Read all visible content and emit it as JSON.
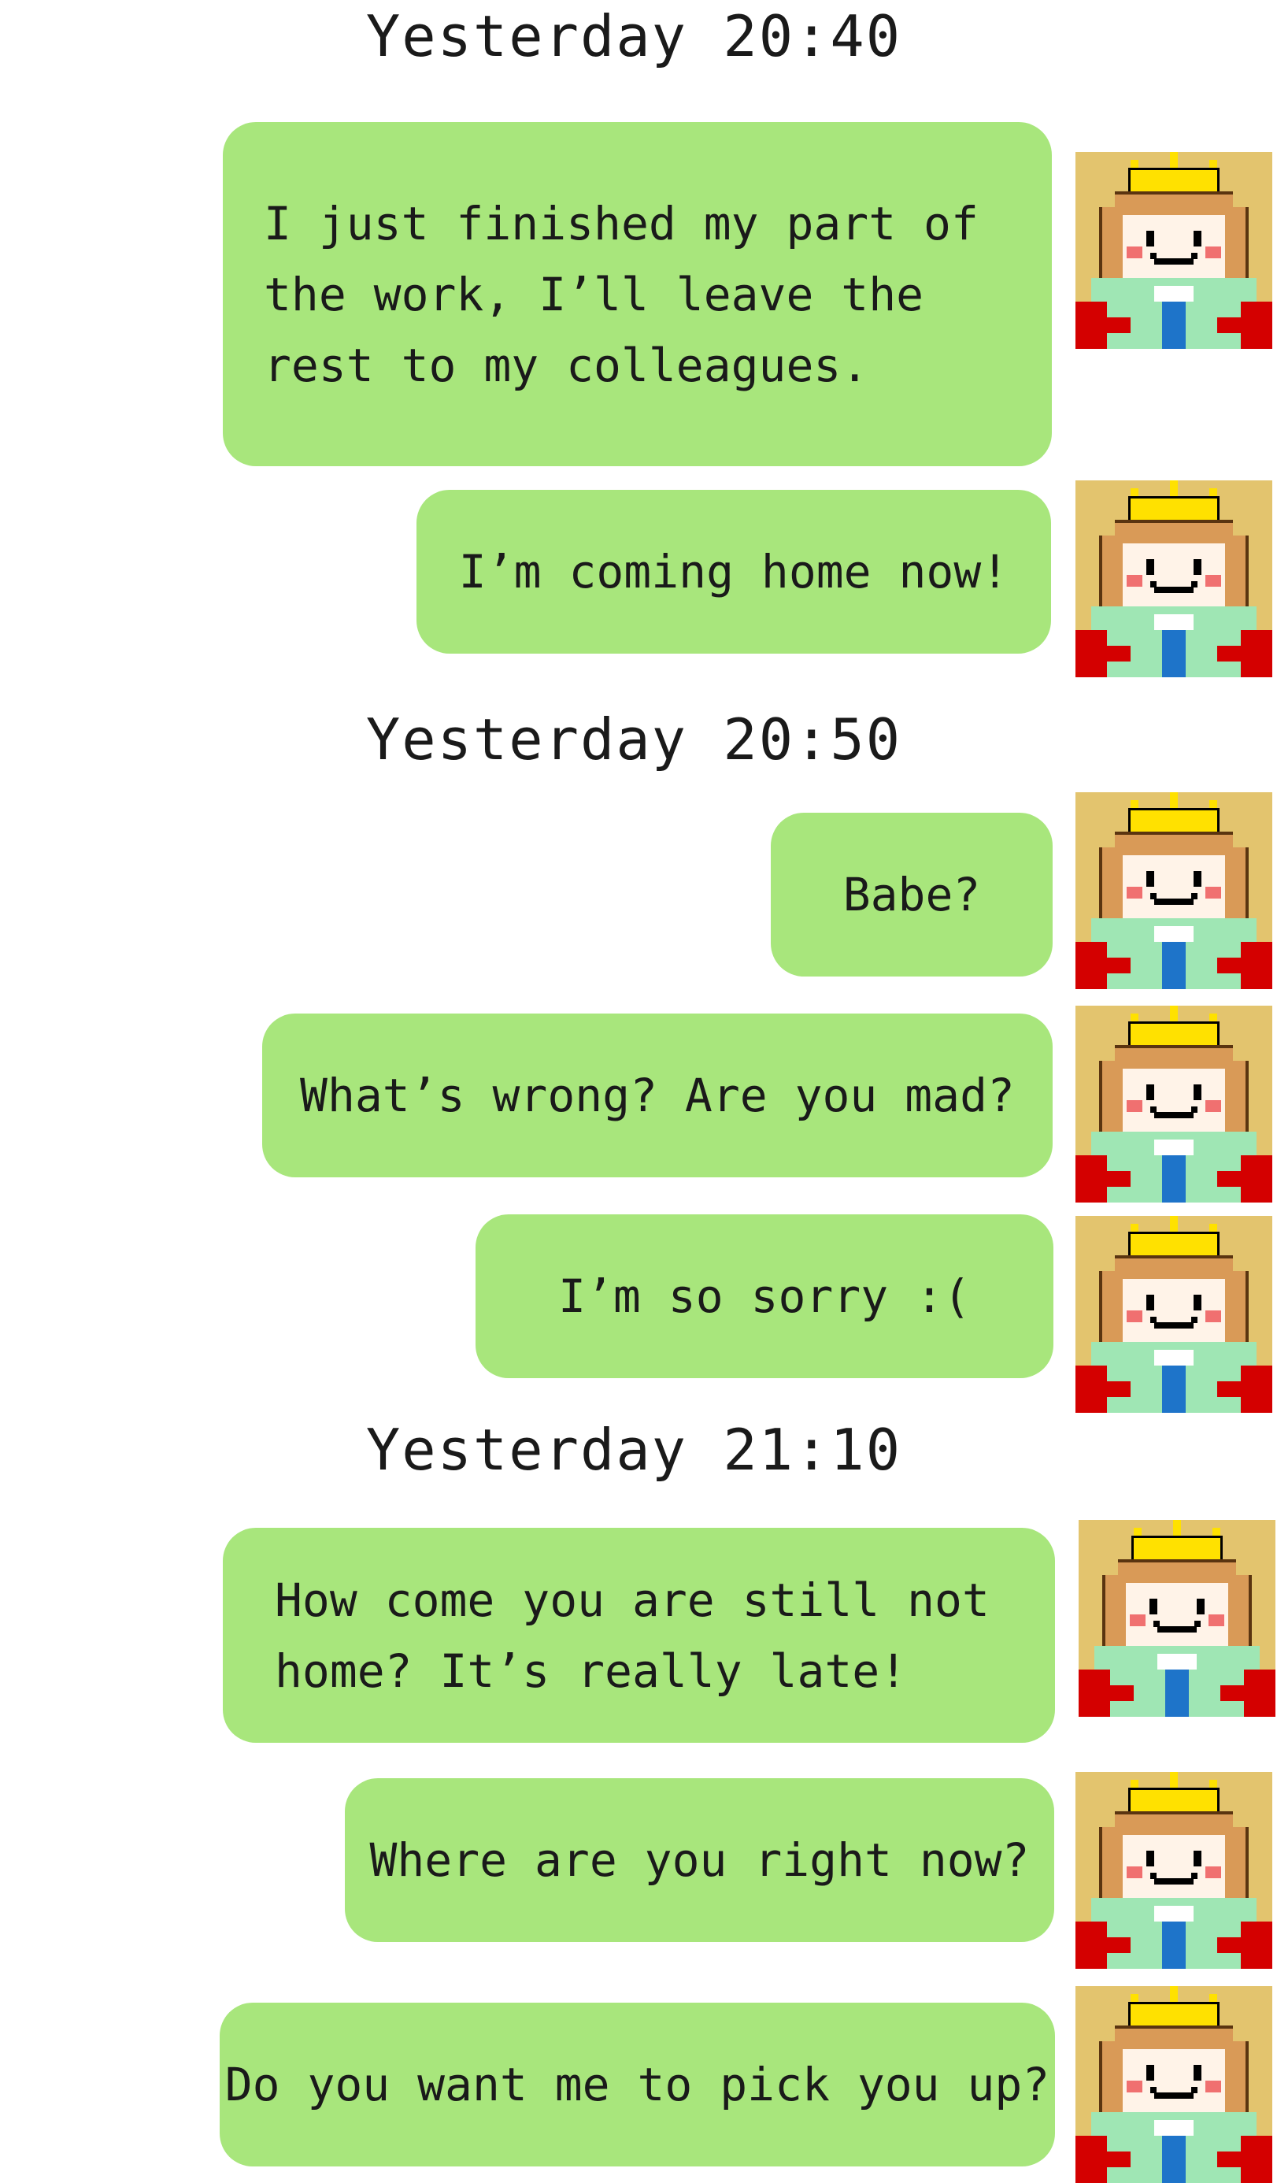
{
  "timestamps": {
    "t1": "Yesterday 20:40",
    "t2": "Yesterday 20:50",
    "t3": "Yesterday 21:10"
  },
  "messages": [
    {
      "text": "I just finished my part of\nthe work, I’ll leave the\nrest to my colleagues.",
      "sender": "self"
    },
    {
      "text": "I’m coming home now!",
      "sender": "self"
    },
    {
      "text": "Babe?",
      "sender": "self"
    },
    {
      "text": "What’s wrong? Are you mad?",
      "sender": "self"
    },
    {
      "text": "I’m so sorry  :(",
      "sender": "self"
    },
    {
      "text": "How come you are still not\nhome? It’s really late!",
      "sender": "self"
    },
    {
      "text": "Where are you right now?",
      "sender": "self"
    },
    {
      "text": "Do you want me to pick you up?",
      "sender": "self"
    }
  ],
  "avatar": {
    "icon": "pixel-king-avatar-icon",
    "background": "#e3c46e",
    "crown": "#ffe100",
    "hair": "#d99a57",
    "robe": "#9fe6b4",
    "cape": "#d40000",
    "tie": "#1e74c9"
  },
  "colors": {
    "bubble": "#a8e67c",
    "background": "#ffffff",
    "text": "#1a1a1a"
  }
}
